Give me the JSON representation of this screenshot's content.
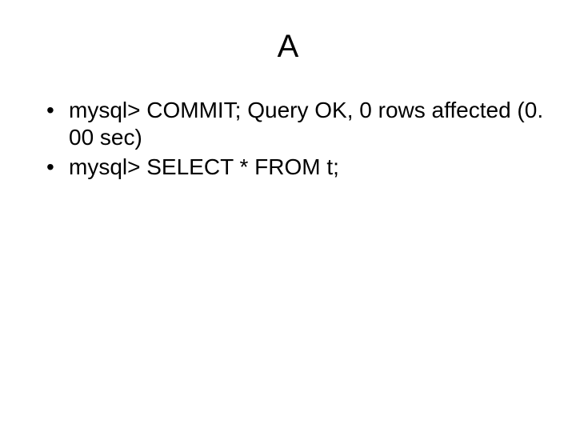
{
  "slide": {
    "title": "A",
    "bullets": [
      "mysql> COMMIT; Query OK, 0 rows affected (0. 00 sec)",
      "mysql> SELECT * FROM t;"
    ]
  }
}
